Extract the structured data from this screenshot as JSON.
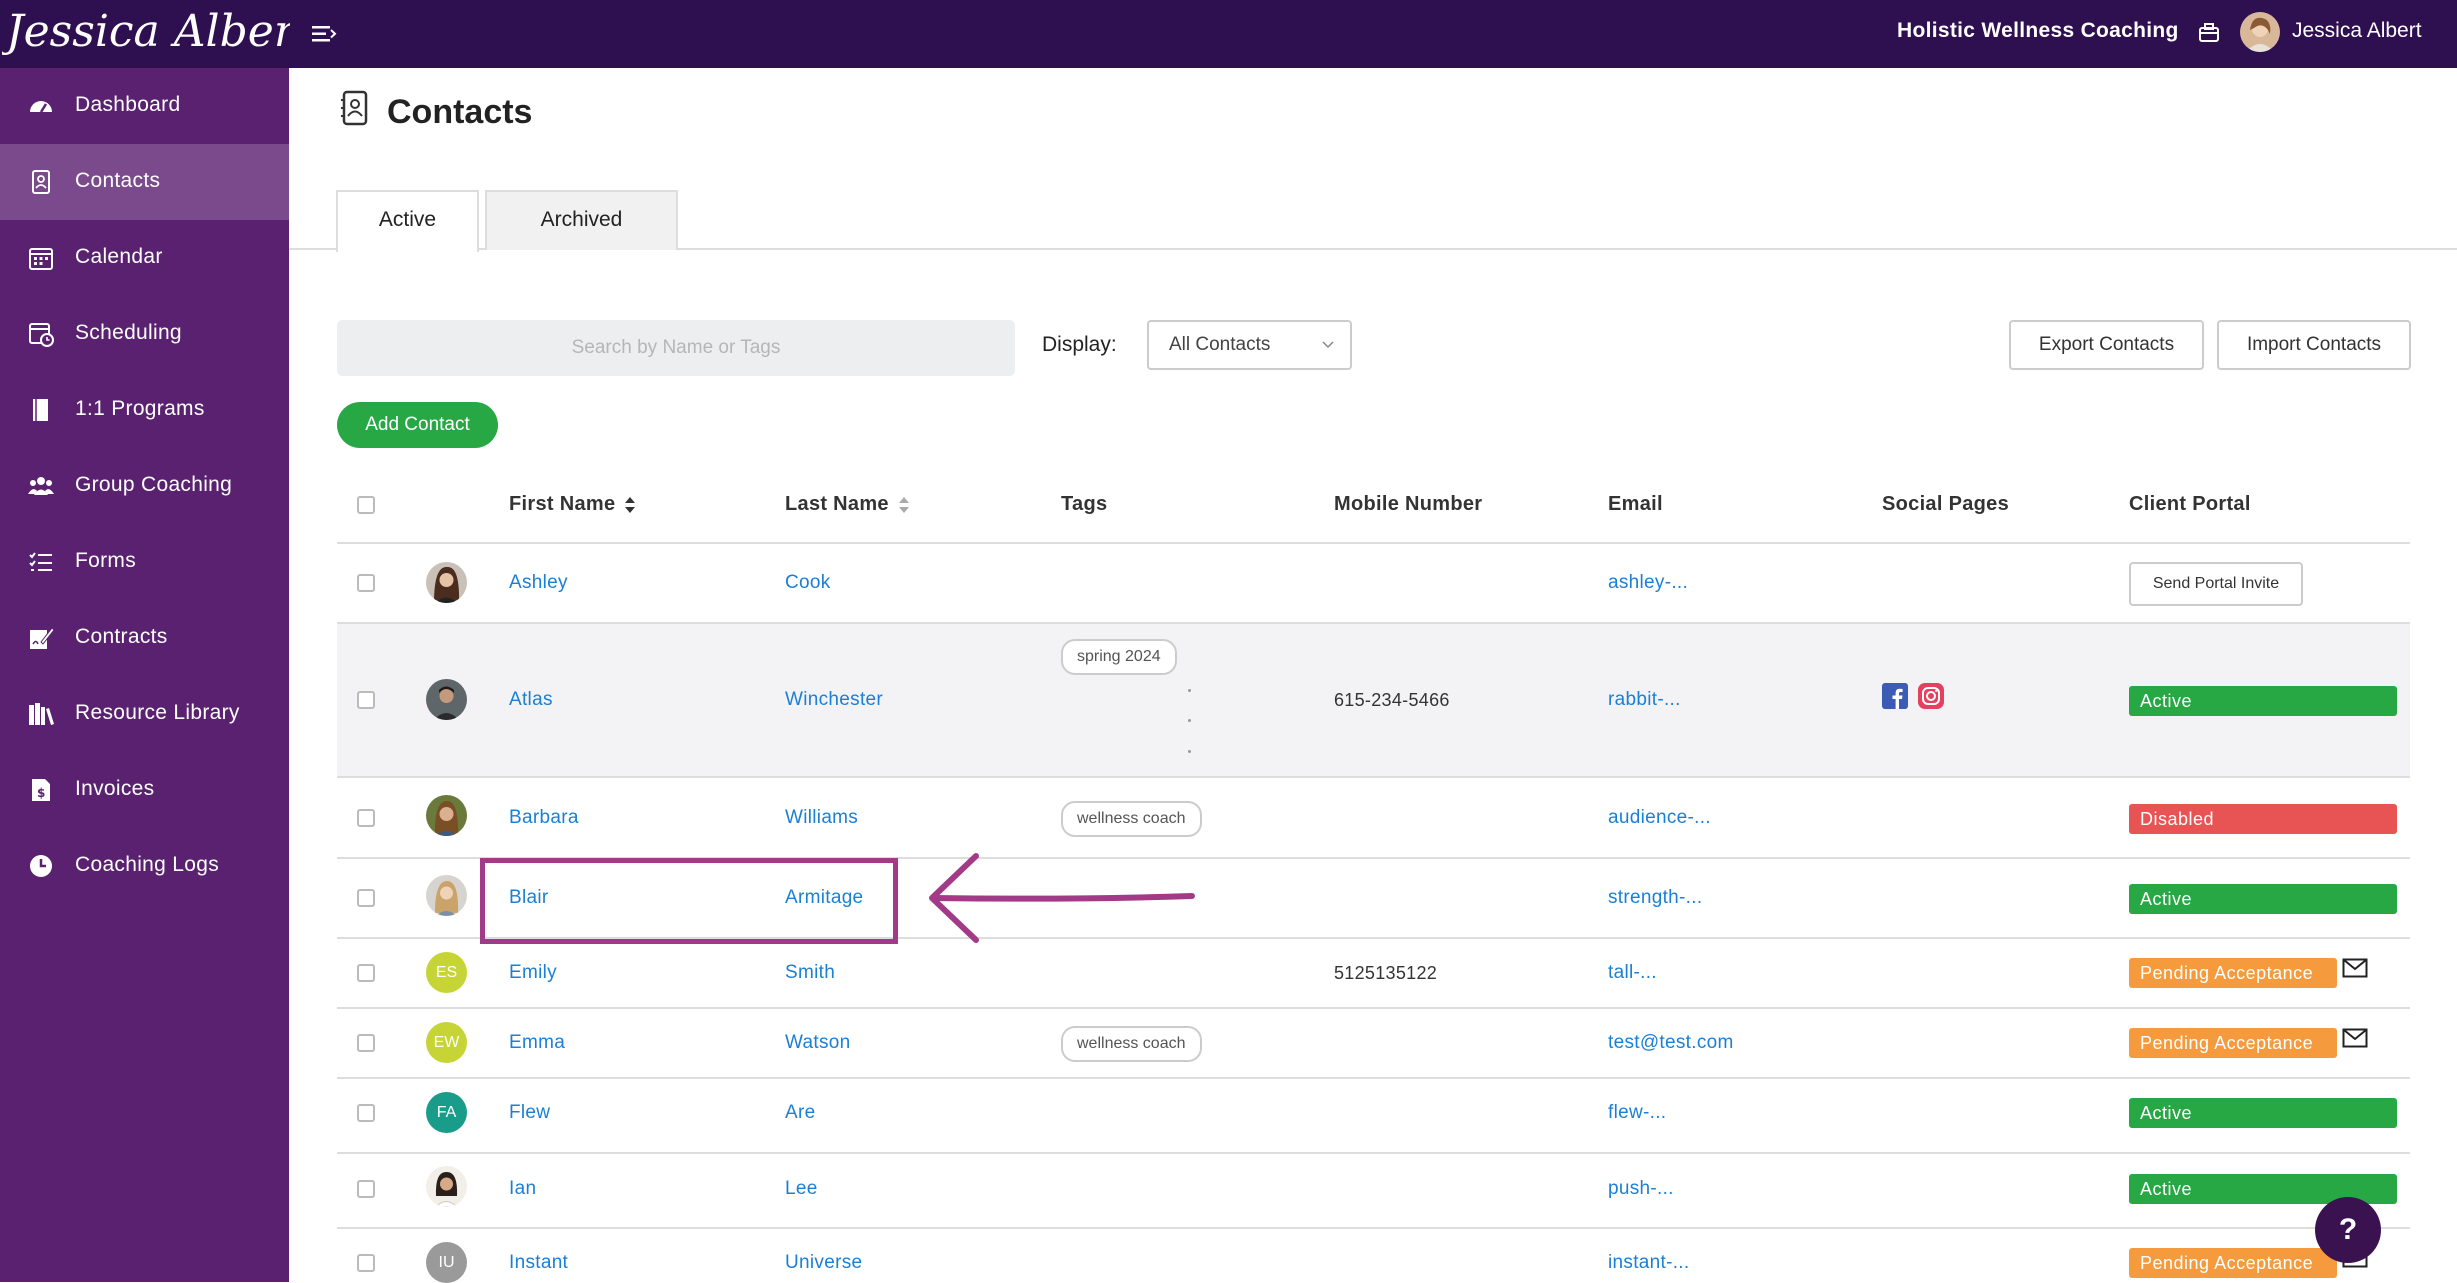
{
  "app": {
    "logo_text": "Jessica Albert",
    "brand": "Holistic Wellness Coaching",
    "user_name": "Jessica Albert"
  },
  "sidebar": {
    "items": [
      {
        "label": "Dashboard",
        "icon": "dashboard-icon"
      },
      {
        "label": "Contacts",
        "icon": "contacts-icon",
        "active": true
      },
      {
        "label": "Calendar",
        "icon": "calendar-icon"
      },
      {
        "label": "Scheduling",
        "icon": "scheduling-icon"
      },
      {
        "label": "1:1 Programs",
        "icon": "book-icon"
      },
      {
        "label": "Group Coaching",
        "icon": "group-icon"
      },
      {
        "label": "Forms",
        "icon": "forms-icon"
      },
      {
        "label": "Contracts",
        "icon": "contract-icon"
      },
      {
        "label": "Resource Library",
        "icon": "library-icon"
      },
      {
        "label": "Invoices",
        "icon": "invoice-icon"
      },
      {
        "label": "Coaching Logs",
        "icon": "clock-icon"
      }
    ]
  },
  "page": {
    "title": "Contacts"
  },
  "tabs": {
    "active": "Active",
    "archived": "Archived"
  },
  "toolbar": {
    "search_placeholder": "Search by Name or Tags",
    "display_label": "Display:",
    "display_value": "All Contacts",
    "export_label": "Export Contacts",
    "import_label": "Import Contacts",
    "add_label": "Add Contact"
  },
  "table": {
    "headers": {
      "first_name": "First Name",
      "last_name": "Last Name",
      "tags": "Tags",
      "mobile": "Mobile Number",
      "email": "Email",
      "social": "Social Pages",
      "portal": "Client Portal"
    },
    "rows": [
      {
        "first": "Ashley",
        "last": "Cook",
        "tag": "",
        "mobile": "",
        "email": "ashley-...",
        "portal": "Send Portal Invite",
        "avatar": "photo"
      },
      {
        "first": "Atlas",
        "last": "Winchester",
        "tag": "spring 2024",
        "mobile": "615-234-5466",
        "email": "rabbit-...",
        "portal": "Active",
        "avatar": "photo"
      },
      {
        "first": "Barbara",
        "last": "Williams",
        "tag": "wellness coach",
        "mobile": "",
        "email": "audience-...",
        "portal": "Disabled",
        "avatar": "photo"
      },
      {
        "first": "Blair",
        "last": "Armitage",
        "tag": "",
        "mobile": "",
        "email": "strength-...",
        "portal": "Active",
        "avatar": "photo"
      },
      {
        "first": "Emily",
        "last": "Smith",
        "tag": "",
        "mobile": "5125135122",
        "email": "tall-...",
        "portal": "Pending Acceptance",
        "avatar": "ES"
      },
      {
        "first": "Emma",
        "last": "Watson",
        "tag": "wellness coach",
        "mobile": "",
        "email": "test@test.com",
        "portal": "Pending Acceptance",
        "avatar": "EW"
      },
      {
        "first": "Flew",
        "last": "Are",
        "tag": "",
        "mobile": "",
        "email": "flew-...",
        "portal": "Active",
        "avatar": "FA"
      },
      {
        "first": "Ian",
        "last": "Lee",
        "tag": "",
        "mobile": "",
        "email": "push-...",
        "portal": "Active",
        "avatar": "photo"
      },
      {
        "first": "Instant",
        "last": "Universe",
        "tag": "",
        "mobile": "",
        "email": "instant-...",
        "portal": "Pending Acceptance",
        "avatar": "IU"
      }
    ]
  },
  "help": {
    "label": "?"
  },
  "colors": {
    "topbar": "#2e0f4f",
    "sidebar": "#5a2170",
    "sidebar_active": "#7a4a8c",
    "link": "#1a7fd6",
    "active": "#28a745",
    "disabled": "#e85454",
    "pending": "#f59b3d",
    "highlight": "#a33a87"
  }
}
